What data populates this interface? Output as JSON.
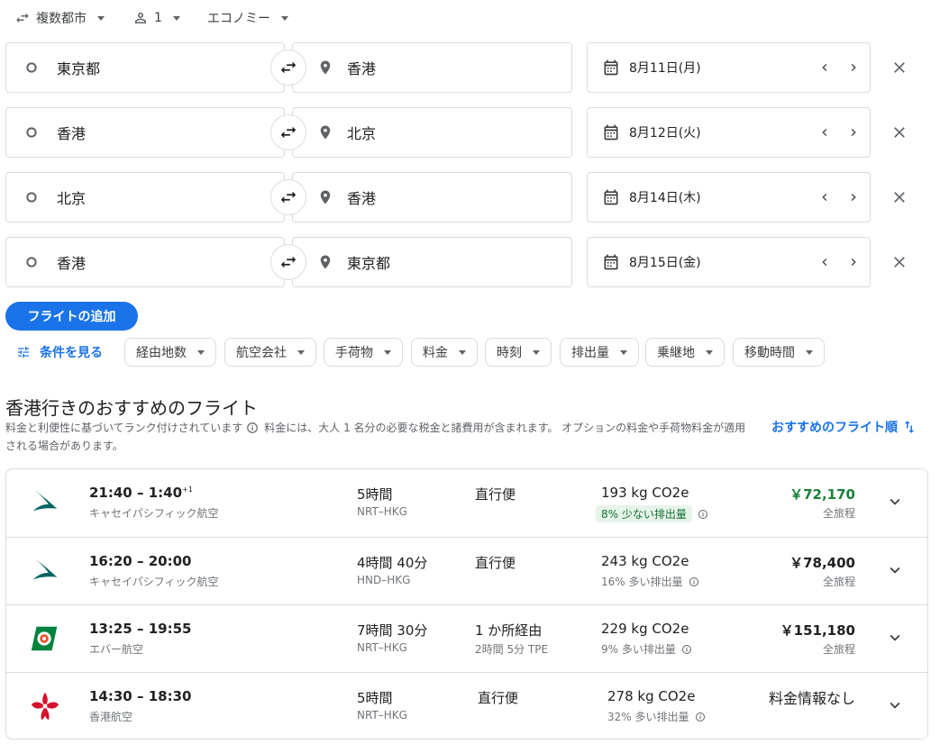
{
  "options": {
    "trip_type": "複数都市",
    "passengers": "1",
    "cabin": "エコノミー"
  },
  "legs": [
    {
      "origin": "東京都",
      "destination": "香港",
      "date": "8月11日(月)"
    },
    {
      "origin": "香港",
      "destination": "北京",
      "date": "8月12日(火)"
    },
    {
      "origin": "北京",
      "destination": "香港",
      "date": "8月14日(木)"
    },
    {
      "origin": "香港",
      "destination": "東京都",
      "date": "8月15日(金)"
    }
  ],
  "add_flight_label": "フライトの追加",
  "filters": {
    "all_label": "条件を見る",
    "chips": [
      "経由地数",
      "航空会社",
      "手荷物",
      "料金",
      "時刻",
      "排出量",
      "乗継地",
      "移動時間"
    ]
  },
  "results": {
    "title": "香港行きのおすすめのフライト",
    "subtitle_a": "料金と利便性に基づいてランク付けされています",
    "subtitle_b": "料金には、大人 1 名分の必要な税金と諸費用が含まれます。 オプションの料金や手荷物料金が適用される場合があります。",
    "sort_label": "おすすめのフライト順",
    "flights": [
      {
        "times": "21:40 – 1:40",
        "plus_day": "+1",
        "airline": "キャセイパシフィック航空",
        "logo": "cathay-logo",
        "duration": "5時間",
        "route": "NRT–HKG",
        "stops": "直行便",
        "stop_detail": "",
        "co2": "193 kg CO2e",
        "emissions": "8% 少ない排出量",
        "emissions_low": true,
        "price": "￥72,170",
        "price_type": "全旅程"
      },
      {
        "times": "16:20 – 20:00",
        "plus_day": "",
        "airline": "キャセイパシフィック航空",
        "logo": "cathay-logo",
        "duration": "4時間 40分",
        "route": "HND–HKG",
        "stops": "直行便",
        "stop_detail": "",
        "co2": "243 kg CO2e",
        "emissions": "16% 多い排出量",
        "emissions_low": false,
        "price": "￥78,400",
        "price_type": "全旅程"
      },
      {
        "times": "13:25 – 19:55",
        "plus_day": "",
        "airline": "エバー航空",
        "logo": "eva-logo",
        "duration": "7時間 30分",
        "route": "NRT–HKG",
        "stops": "1 か所経由",
        "stop_detail": "2時間 5分 TPE",
        "co2": "229 kg CO2e",
        "emissions": "9% 多い排出量",
        "emissions_low": false,
        "price": "￥151,180",
        "price_type": "全旅程"
      },
      {
        "times": "14:30 – 18:30",
        "plus_day": "",
        "airline": "香港航空",
        "logo": "hk-airlines-logo",
        "duration": "5時間",
        "route": "NRT–HKG",
        "stops": "直行便",
        "stop_detail": "",
        "co2": "278 kg CO2e",
        "emissions": "32% 多い排出量",
        "emissions_low": false,
        "price": "料金情報なし",
        "price_type": ""
      }
    ]
  },
  "colors": {
    "accent": "#1a73e8",
    "price_green": "#188038",
    "cathay": "#006564",
    "eva": "#00843d",
    "hk_airlines": "#d7102b"
  }
}
